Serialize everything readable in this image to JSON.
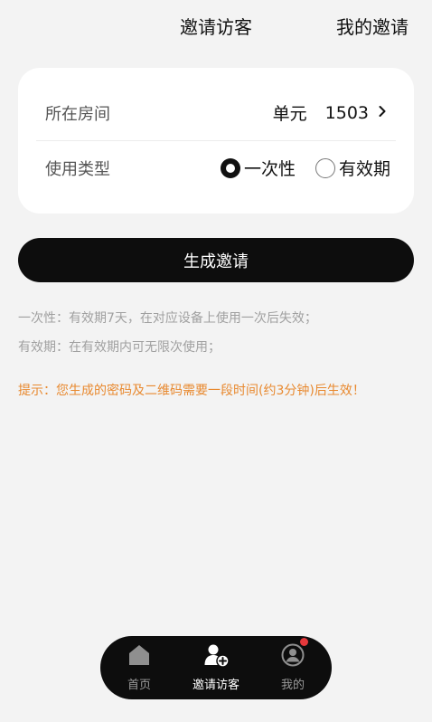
{
  "header": {
    "title": "邀请访客",
    "action_label": "我的邀请"
  },
  "form": {
    "room": {
      "label": "所在房间",
      "unit": "单元",
      "number": "1503",
      "chevron_icon": "chevron-right-icon"
    },
    "type": {
      "label": "使用类型",
      "options": [
        {
          "label": "一次性",
          "selected": true
        },
        {
          "label": "有效期",
          "selected": false
        }
      ]
    }
  },
  "submit": {
    "label": "生成邀请"
  },
  "notes": {
    "one_time": "一次性：有效期7天，在对应设备上使用一次后失效；",
    "validity": "有效期：在有效期内可无限次使用；",
    "tip": "提示：您生成的密码及二维码需要一段时间(约3分钟)后生效！"
  },
  "tabbar": {
    "items": [
      {
        "label": "首页",
        "icon": "home-icon",
        "active": false
      },
      {
        "label": "邀请访客",
        "icon": "add-visitor-icon",
        "active": true
      },
      {
        "label": "我的",
        "icon": "profile-icon",
        "active": false,
        "badge": true
      }
    ]
  },
  "colors": {
    "background": "#f3f3f3",
    "card": "#ffffff",
    "primary_button": "#0d0d0d",
    "note_text": "#a0a0a0",
    "tip_text": "#e8892f",
    "badge": "#e5383b"
  }
}
